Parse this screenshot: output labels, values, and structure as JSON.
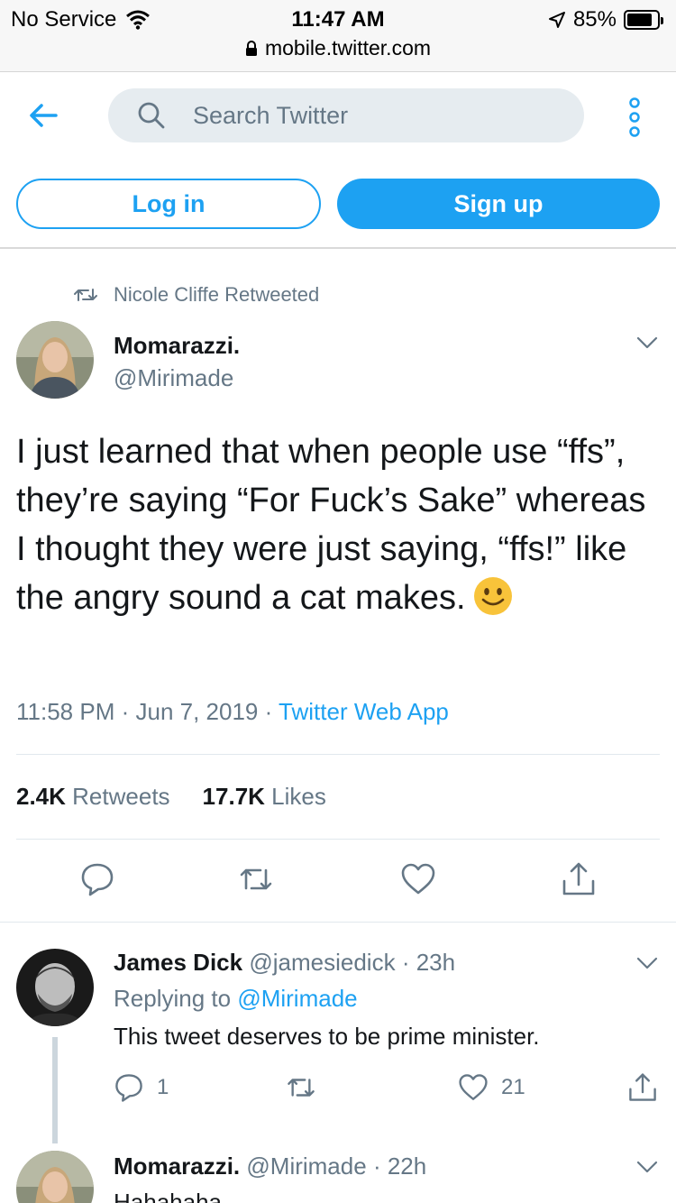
{
  "status_bar": {
    "carrier": "No Service",
    "time": "11:47 AM",
    "battery": "85%",
    "battery_level": 0.85,
    "url": "mobile.twitter.com"
  },
  "header": {
    "search_placeholder": "Search Twitter"
  },
  "auth": {
    "login_label": "Log in",
    "signup_label": "Sign up"
  },
  "tweet": {
    "retweeted_by": "Nicole Cliffe Retweeted",
    "name": "Momarazzi.",
    "handle": "@Mirimade",
    "text": "I just learned that when people use “ffs”, they’re saying “For Fuck’s Sake” whereas I thought they were just saying, “ffs!” like the angry sound a cat makes.",
    "time": "11:58 PM",
    "date": "Jun 7, 2019",
    "source": "Twitter Web App",
    "retweets_count": "2.4K",
    "retweets_label": "Retweets",
    "likes_count": "17.7K",
    "likes_label": "Likes"
  },
  "reply": {
    "name": "James Dick",
    "handle": "@jamesiedick",
    "age": "23h",
    "replying_prefix": "Replying to",
    "replying_to": "@Mirimade",
    "text": "This tweet deserves to be prime minister.",
    "reply_count": "1",
    "like_count": "21"
  },
  "next_reply": {
    "name": "Momarazzi.",
    "handle": "@Mirimade",
    "age": "22h",
    "text": "Hahahaha"
  },
  "colors": {
    "accent": "#1da1f2",
    "secondary_text": "#657786",
    "search_bg": "#e6ecf0"
  }
}
